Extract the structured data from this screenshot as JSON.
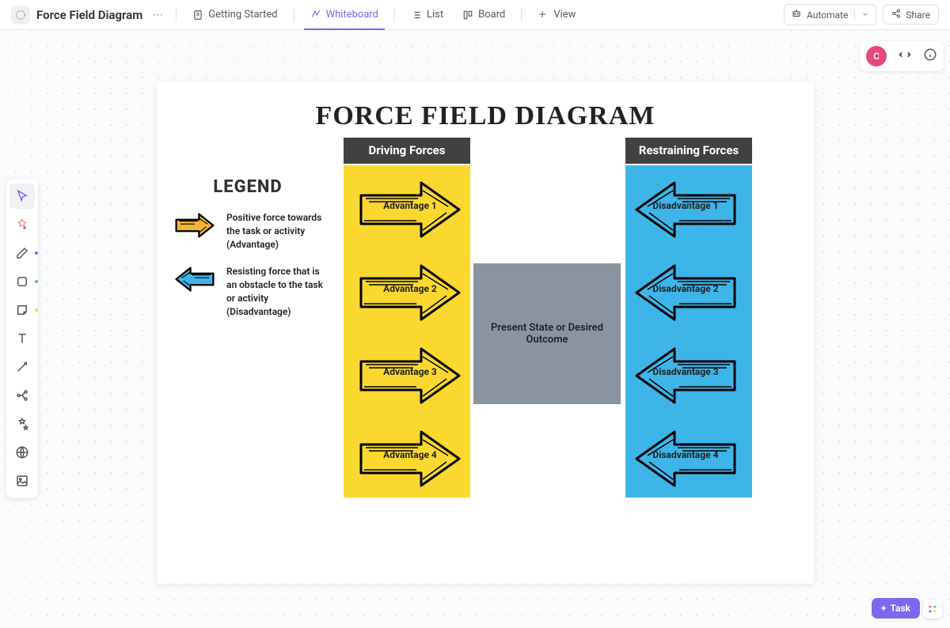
{
  "header": {
    "title": "Force Field Diagram",
    "tabs": [
      {
        "label": "Getting Started"
      },
      {
        "label": "Whiteboard"
      },
      {
        "label": "List"
      },
      {
        "label": "Board"
      },
      {
        "label": "View"
      }
    ],
    "automate": "Automate",
    "share": "Share"
  },
  "avatar": "C",
  "board": {
    "title": "FORCE FIELD DIAGRAM",
    "legend": {
      "title": "LEGEND",
      "positive": "Positive force towards the task or activity (Advantage)",
      "negative": "Resisting force that is an obstacle to the task or activity (Disadvantage)"
    },
    "driving": {
      "header": "Driving Forces",
      "items": [
        "Advantage 1",
        "Advantage 2",
        "Advantage 3",
        "Advantage 4"
      ]
    },
    "restraining": {
      "header": "Restraining Forces",
      "items": [
        "Disadvantage 1",
        "Disadvantage 2",
        "Disadvantage 3",
        "Disadvantage 4"
      ]
    },
    "center": "Present State or Desired Outcome"
  },
  "task_btn": "Task"
}
